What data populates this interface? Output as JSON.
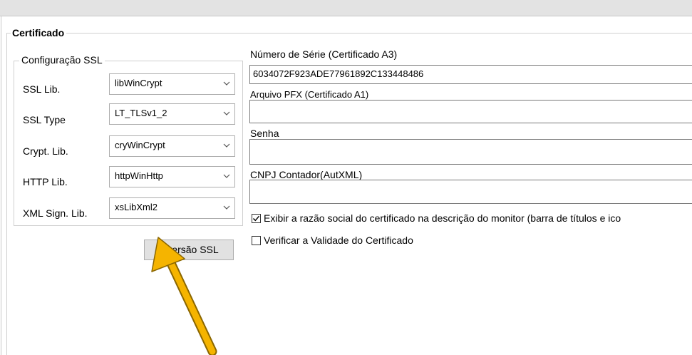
{
  "certificado": {
    "title": "Certificado",
    "ssl_group": {
      "title": "Configuração SSL",
      "rows": [
        {
          "label": "SSL Lib.",
          "value": "libWinCrypt"
        },
        {
          "label": "SSL Type",
          "value": "LT_TLSv1_2"
        },
        {
          "label": "Crypt. Lib.",
          "value": "cryWinCrypt"
        },
        {
          "label": "HTTP Lib.",
          "value": "httpWinHttp"
        },
        {
          "label": "XML Sign. Lib.",
          "value": "xsLibXml2"
        }
      ]
    },
    "versao_button": "ersão SSL",
    "numero_serie_label": "Número de Série (Certificado A3)",
    "numero_serie_value": "6034072F923ADE77961892C133448486",
    "arquivo_pfx_label": "Arquivo PFX (Certificado A1)",
    "arquivo_pfx_value": "",
    "senha_label": "Senha",
    "senha_value": "",
    "cnpj_label": "CNPJ Contador(AutXML)",
    "cnpj_value": "",
    "exibir_razao": {
      "label": "Exibir a razão social do certificado na descrição do monitor (barra de títulos e ico",
      "checked": true
    },
    "verificar_validade": {
      "label": "Verificar a Validade do Certificado",
      "checked": false
    }
  },
  "colors": {
    "annotation_arrow": "#f5b400",
    "button_bg": "#e1e1e1"
  }
}
